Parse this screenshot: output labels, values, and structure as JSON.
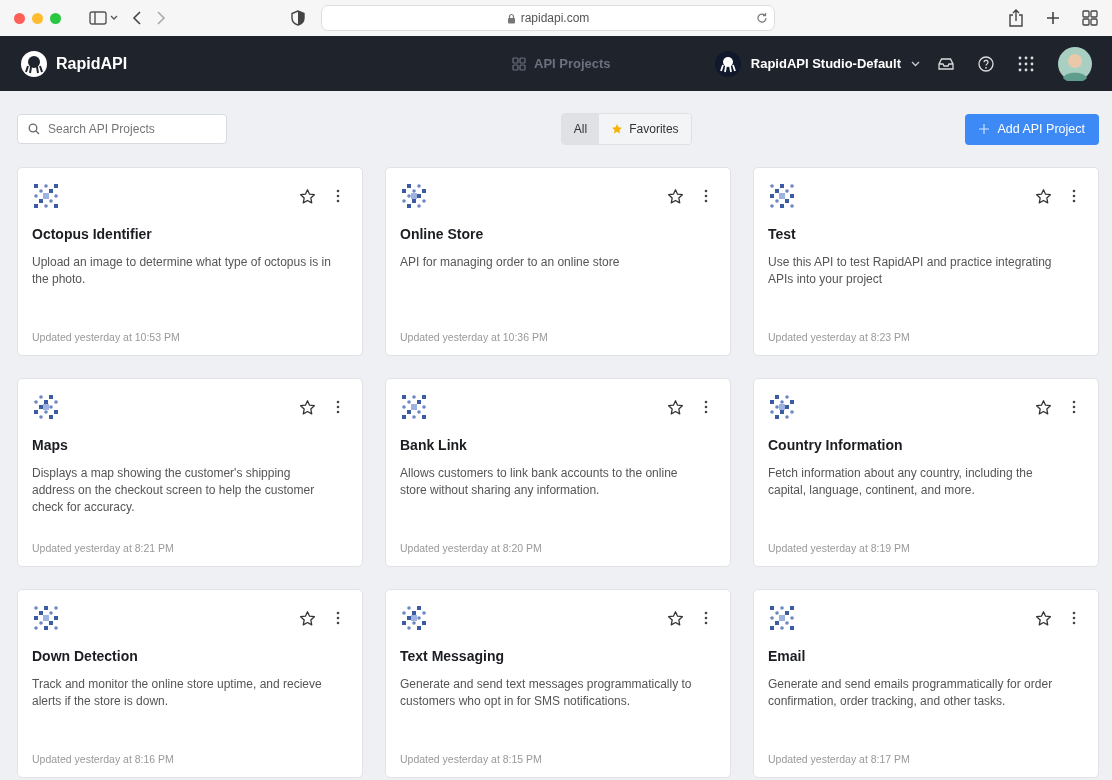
{
  "browser": {
    "url": "rapidapi.com"
  },
  "nav": {
    "brand": "RapidAPI",
    "center_link": "API Projects",
    "workspace": "RapidAPI Studio-Default"
  },
  "toolbar": {
    "search": {
      "placeholder": "Search API Projects"
    },
    "filters": [
      {
        "label": "All",
        "selected": true
      },
      {
        "label": "Favorites",
        "selected": false
      }
    ],
    "add_button": "Add API Project"
  },
  "projects": [
    {
      "title": "Octopus Identifier",
      "description": "Upload an image to determine what type of octopus is in the photo.",
      "updated": "Updated yesterday at 10:53 PM",
      "favorite": false
    },
    {
      "title": "Online Store",
      "description": "API for managing order to an online store",
      "updated": "Updated yesterday at 10:36 PM",
      "favorite": false
    },
    {
      "title": "Test",
      "description": "Use this API to test RapidAPI and practice integrating APIs into your project",
      "updated": "Updated yesterday at 8:23 PM",
      "favorite": false
    },
    {
      "title": "Maps",
      "description": "Displays a map showing the customer's shipping address on the checkout screen to help the customer check for accuracy.",
      "updated": "Updated yesterday at 8:21 PM",
      "favorite": false
    },
    {
      "title": "Bank Link",
      "description": "Allows customers to link bank accounts to the online store without sharing any information.",
      "updated": "Updated yesterday at 8:20 PM",
      "favorite": false
    },
    {
      "title": "Country Information",
      "description": "Fetch information about any country, including the capital, language, continent, and more.",
      "updated": "Updated yesterday at 8:19 PM",
      "favorite": false
    },
    {
      "title": "Down Detection",
      "description": "Track and monitor the online store uptime, and recieve alerts if the store is down.",
      "updated": "Updated yesterday at 8:16 PM",
      "favorite": false
    },
    {
      "title": "Text Messaging",
      "description": "Generate and send text messages programmatically to customers who opt in for SMS notifications.",
      "updated": "Updated yesterday at 8:15 PM",
      "favorite": false
    },
    {
      "title": "Email",
      "description": "Generate and send emails programmatically for order confirmation, order tracking, and other tasks.",
      "updated": "Updated yesterday at 8:17 PM",
      "favorite": false
    }
  ]
}
